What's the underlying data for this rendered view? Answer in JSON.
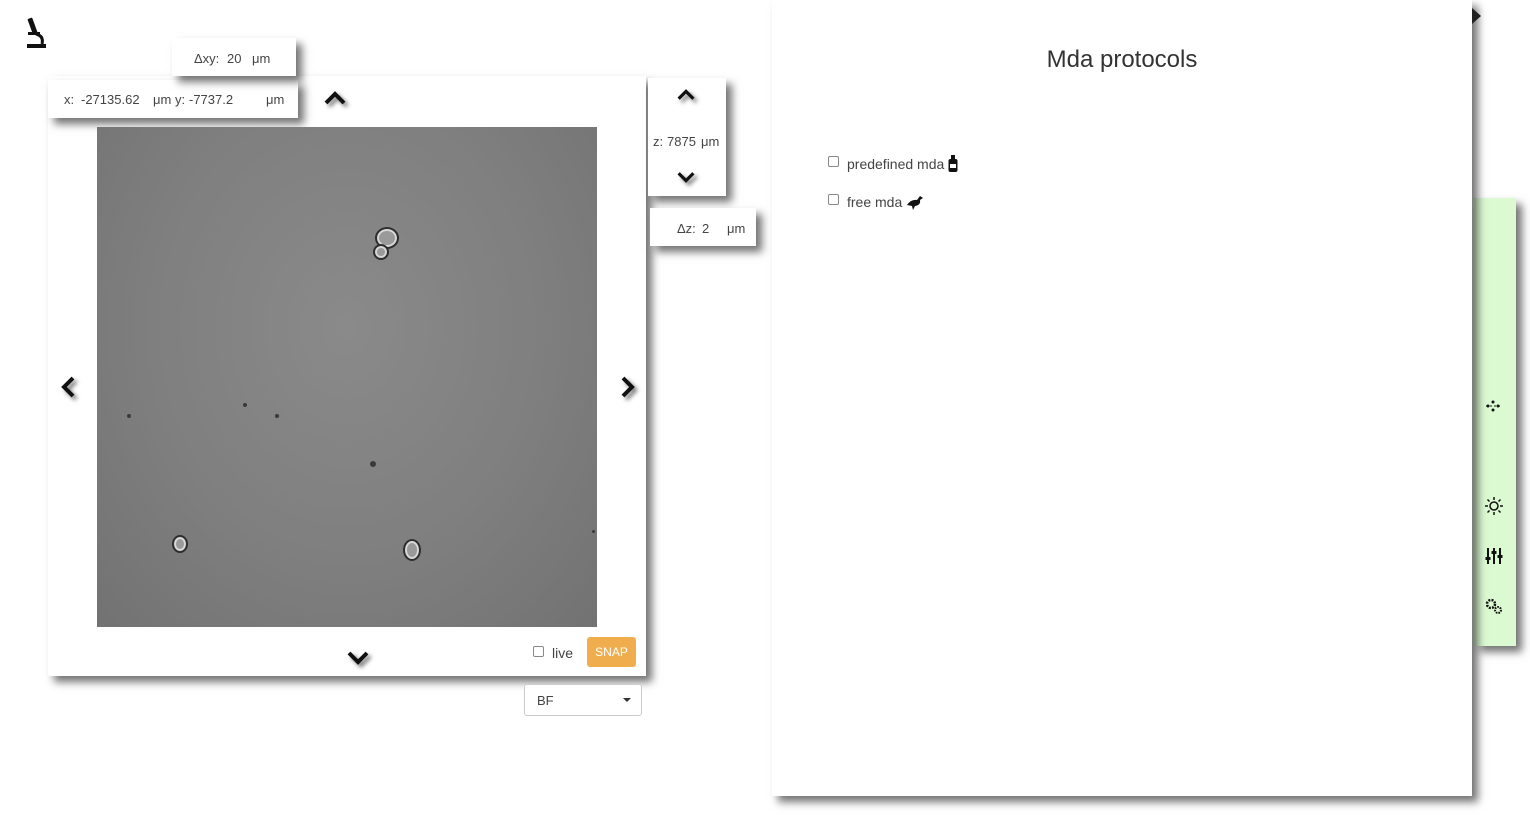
{
  "viewer": {
    "dxy_label": "Δxy:",
    "dxy_value": "20",
    "dxy_unit": "μm",
    "x_label": "x:",
    "x_value": "-27135.62",
    "x_unit": "μm",
    "y_label": "y:",
    "y_value": "-7737.2",
    "y_unit": "μm",
    "z_label": "z:",
    "z_value": "7875",
    "z_unit": "μm",
    "dz_label": "Δz:",
    "dz_value": "2",
    "dz_unit": "μm",
    "live_label": "live",
    "snap_label": "SNAP",
    "channel_selected": "BF"
  },
  "mda": {
    "title": "Mda protocols",
    "options": [
      {
        "label": "predefined mda",
        "icon": "bottle-icon"
      },
      {
        "label": "free mda",
        "icon": "bird-icon"
      }
    ]
  },
  "colors": {
    "snap_button": "#f0ad4e",
    "right_strip": "#dcfad2"
  },
  "right_strip_icons": [
    "scatter-icon",
    "brightness-icon",
    "sliders-icon",
    "gears-icon"
  ]
}
